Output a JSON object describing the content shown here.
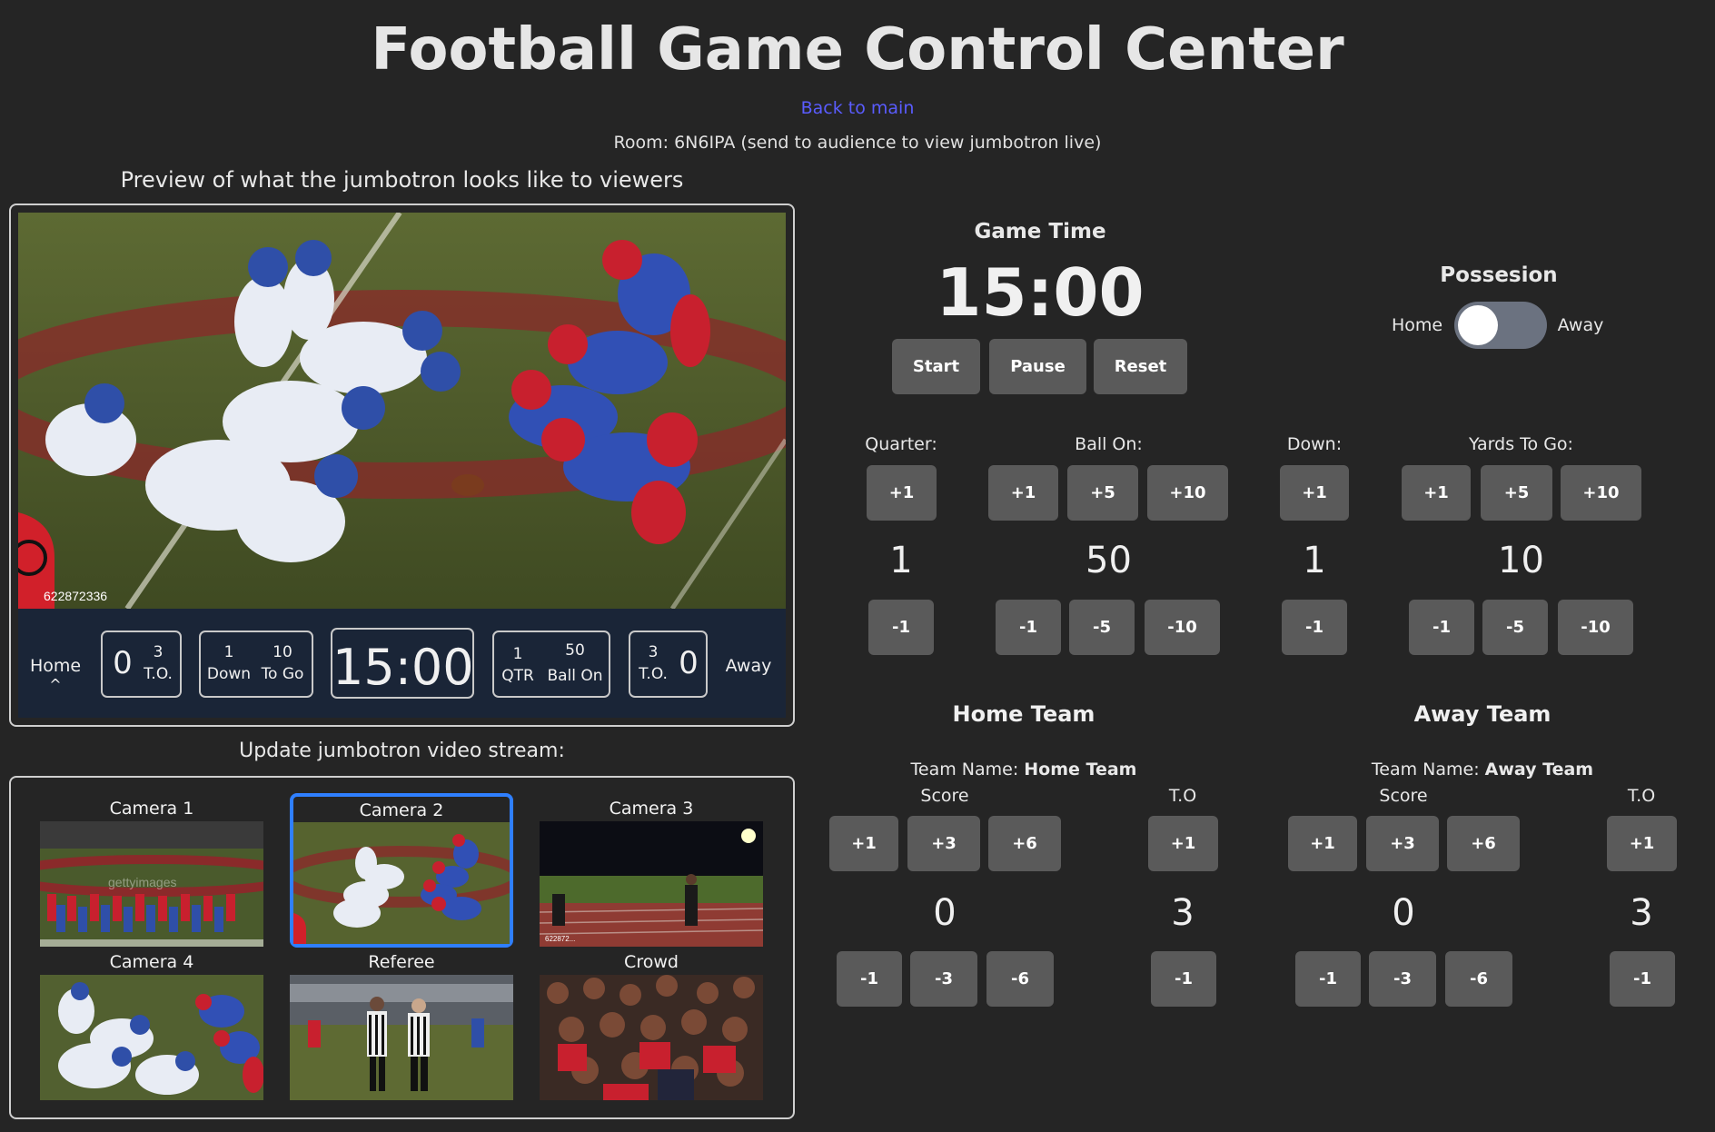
{
  "page": {
    "title": "Football Game Control Center",
    "back_link": "Back to main",
    "room_text": "Room: 6N6IPA (send to audience to view jumbotron live)"
  },
  "preview": {
    "heading": "Preview of what the jumbotron looks like to viewers",
    "image_watermark": "622872336",
    "scoreboard": {
      "home_label": "Home",
      "home_possession_marker": "^",
      "home_score": "0",
      "home_to": "3",
      "home_to_label": "T.O.",
      "down": "1",
      "down_label": "Down",
      "to_go": "10",
      "to_go_label": "To Go",
      "clock": "15:00",
      "qtr": "1",
      "qtr_label": "QTR",
      "ball_on": "50",
      "ball_on_label": "Ball On",
      "away_to": "3",
      "away_to_label": "T.O.",
      "away_score": "0",
      "away_label": "Away"
    }
  },
  "stream": {
    "heading": "Update jumbotron video stream:",
    "cameras": [
      {
        "label": "Camera 1"
      },
      {
        "label": "Camera 2"
      },
      {
        "label": "Camera 3"
      },
      {
        "label": "Camera 4"
      },
      {
        "label": "Referee"
      },
      {
        "label": "Crowd"
      }
    ],
    "selected": "Camera 2",
    "thumb_marks": [
      "622872...",
      "gettyimages"
    ]
  },
  "game_time": {
    "heading": "Game Time",
    "clock": "15:00",
    "start_label": "Start",
    "pause_label": "Pause",
    "reset_label": "Reset"
  },
  "possession": {
    "heading": "Possesion",
    "home_label": "Home",
    "away_label": "Away",
    "current": "Home"
  },
  "quarter": {
    "label": "Quarter:",
    "value": "1",
    "plus": [
      "+1"
    ],
    "minus": [
      "-1"
    ]
  },
  "ball_on": {
    "label": "Ball On:",
    "value": "50",
    "plus": [
      "+1",
      "+5",
      "+10"
    ],
    "minus": [
      "-1",
      "-5",
      "-10"
    ]
  },
  "down": {
    "label": "Down:",
    "value": "1",
    "plus": [
      "+1"
    ],
    "minus": [
      "-1"
    ]
  },
  "yards_to_go": {
    "label": "Yards To Go:",
    "value": "10",
    "plus": [
      "+1",
      "+5",
      "+10"
    ],
    "minus": [
      "-1",
      "-5",
      "-10"
    ]
  },
  "home_team": {
    "heading": "Home Team",
    "team_name_label": "Team Name:",
    "team_name": "Home Team",
    "score_label": "Score",
    "to_label": "T.O",
    "score": "0",
    "to": "3",
    "score_plus": [
      "+1",
      "+3",
      "+6"
    ],
    "score_minus": [
      "-1",
      "-3",
      "-6"
    ],
    "to_plus": "+1",
    "to_minus": "-1"
  },
  "away_team": {
    "heading": "Away Team",
    "team_name_label": "Team Name:",
    "team_name": "Away Team",
    "score_label": "Score",
    "to_label": "T.O",
    "score": "0",
    "to": "3",
    "score_plus": [
      "+1",
      "+3",
      "+6"
    ],
    "score_minus": [
      "-1",
      "-3",
      "-6"
    ],
    "to_plus": "+1",
    "to_minus": "-1"
  },
  "colors": {
    "background": "#252525",
    "button": "#5a5a5a",
    "link": "#5a5cff",
    "selected_border": "#2f7fff",
    "scoreboard_bg": "#1a2537"
  }
}
